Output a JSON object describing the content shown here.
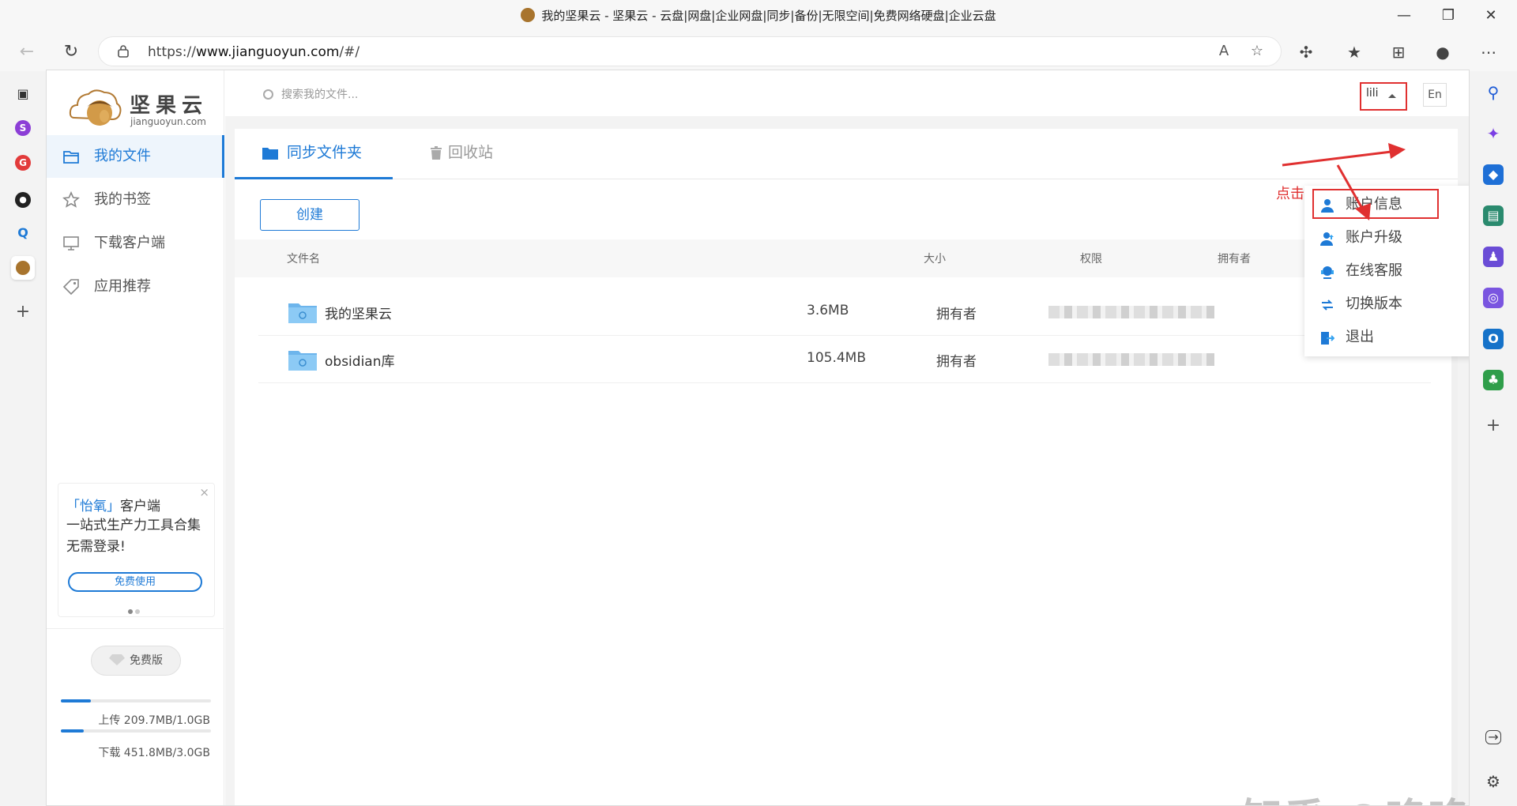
{
  "browser": {
    "window_title": "我的坚果云 - 坚果云 - 云盘|网盘|企业网盘|同步|备份|无限空间|免费网络硬盘|企业云盘",
    "url_prefix": "https://",
    "url_domain": "www.jianguoyun.com",
    "url_path": "/#/",
    "vertical_tabs": [
      "reader-icon",
      "s-app-icon",
      "g-app-icon",
      "github-icon",
      "search-app-icon",
      "jianguoyun-tab-icon",
      "new-tab-icon"
    ],
    "sidebar_icons": [
      "search-icon",
      "copilot-icon",
      "shopping-icon",
      "tools-icon",
      "games-icon",
      "office-icon",
      "outlook-icon",
      "tree-icon",
      "add-icon"
    ]
  },
  "brand": {
    "logo_cn": "坚果云",
    "logo_en": "jianguoyun.com"
  },
  "sidebar": {
    "items": [
      {
        "label": "我的文件"
      },
      {
        "label": "我的书签"
      },
      {
        "label": "下载客户端"
      },
      {
        "label": "应用推荐"
      }
    ],
    "promo": {
      "highlight": "「怡氧」",
      "line1_rest": "客户端",
      "line2": "一站式生产力工具合集 无需登录!",
      "button": "免费使用",
      "close": "×"
    },
    "plan": {
      "label": "免费版",
      "upload_text": "上传 209.7MB/1.0GB",
      "upload_fraction": 0.2,
      "download_text": "下载 451.8MB/3.0GB",
      "download_fraction": 0.15
    }
  },
  "topbar": {
    "search_placeholder": "搜索我的文件...",
    "username": "lili",
    "lang": "En"
  },
  "tabs": [
    {
      "label": "同步文件夹"
    },
    {
      "label": "回收站"
    }
  ],
  "create_button": "创建",
  "table": {
    "headers": [
      "文件名",
      "大小",
      "权限",
      "拥有者"
    ],
    "rows": [
      {
        "name": "我的坚果云",
        "size": "3.6MB",
        "permission": "拥有者"
      },
      {
        "name": "obsidian库",
        "size": "105.4MB",
        "permission": "拥有者"
      }
    ]
  },
  "dropdown": {
    "items": [
      {
        "label": "账户信息"
      },
      {
        "label": "账户升级"
      },
      {
        "label": "在线客服"
      },
      {
        "label": "切换版本"
      },
      {
        "label": "退出"
      }
    ]
  },
  "annotation": {
    "text": "点击",
    "color": "#e03030"
  },
  "watermark": "知乎 @咯咯咯",
  "colors": {
    "accent": "#1e7ad6",
    "annotation_red": "#e03030"
  }
}
